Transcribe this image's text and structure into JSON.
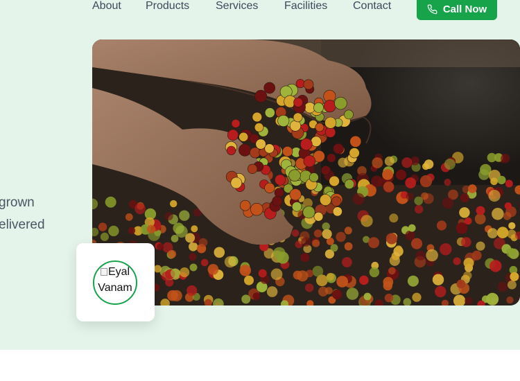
{
  "nav": {
    "items": [
      "About",
      "Products",
      "Services",
      "Facilities",
      "Contact"
    ],
    "cta_label": "Call Now",
    "cta_icon": "phone-icon"
  },
  "hero": {
    "tagline_line1": "grown",
    "tagline_line2": "elivered",
    "photo_icon": "coffee-cherries-in-hands-photo"
  },
  "logo": {
    "alt_text": "Eyal Vanam ...",
    "alt_line1": "Eyal",
    "alt_line2": "Vanam",
    "alt_line3": "..."
  },
  "colors": {
    "accent": "#16a34a",
    "hero_bg": "#e4f4ea",
    "nav_text": "#3c4a5b"
  }
}
